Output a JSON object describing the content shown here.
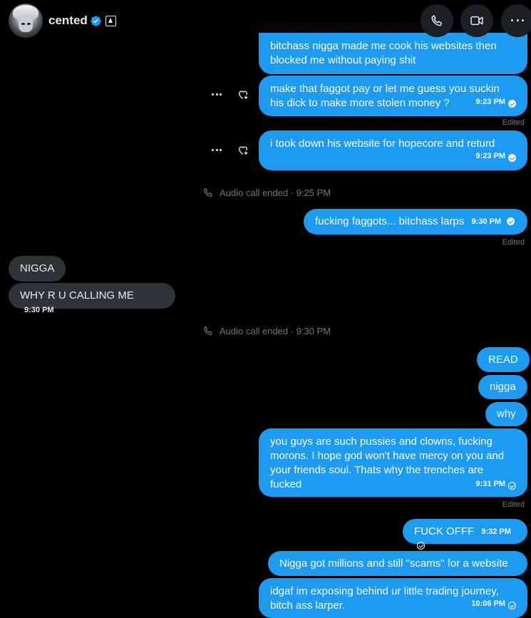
{
  "header": {
    "name": "cented",
    "colors": {
      "accent": "#1d9bf0",
      "incoming": "#2f3336"
    }
  },
  "messages": {
    "m1": "bitchass nigga made me cook his websites then blocked me without paying shit",
    "m2": {
      "text": "make that faggot pay or let me guess you suckin his dick to make more stolen money ?",
      "time": "9:23 PM"
    },
    "m2_edited": "Edited",
    "m3": {
      "text": "i took down his website for hopecore and returd",
      "time": "9:23 PM"
    },
    "call1": "Audio call ended · 9:25 PM",
    "m4": {
      "text": "fucking faggots... bitchass larps",
      "time": "9:30 PM"
    },
    "m4_edited": "Edited",
    "in1": "NIGGA",
    "in2": {
      "text": "WHY R U CALLING ME",
      "time": "9:30 PM"
    },
    "call2": "Audio call ended · 9:30 PM",
    "m5": "READ",
    "m6": "nigga",
    "m7": "why",
    "m8": {
      "text": "you guys are such pussies and clowns, fucking morons.  I hope god won't have mercy on you and your friends soul. Thats why the trenches are fucked",
      "time": "9:31 PM"
    },
    "m8_edited": "Edited",
    "m9": {
      "text": "FUCK OFFF",
      "time": "9:32 PM"
    },
    "m10": "Nigga got millions and still \"scams\" for a website",
    "m11": {
      "text": "idgaf im exposing behind ur little trading journey, bitch ass larper.",
      "time": "10:06 PM"
    }
  }
}
